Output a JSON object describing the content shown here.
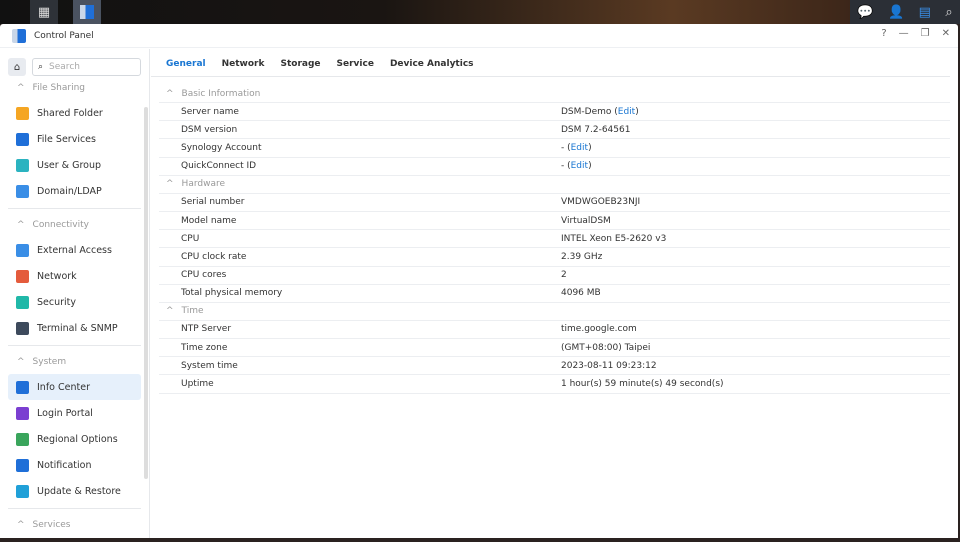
{
  "window": {
    "title": "Control Panel"
  },
  "sidebar": {
    "search_placeholder": "Search",
    "sections": [
      {
        "title": "File Sharing",
        "items": [
          {
            "label": "Shared Folder",
            "color": "#f5a623"
          },
          {
            "label": "File Services",
            "color": "#1f6fd8"
          },
          {
            "label": "User & Group",
            "color": "#2bb3c0"
          },
          {
            "label": "Domain/LDAP",
            "color": "#3a8ee6"
          }
        ]
      },
      {
        "title": "Connectivity",
        "items": [
          {
            "label": "External Access",
            "color": "#3a8ee6"
          },
          {
            "label": "Network",
            "color": "#e45b3c"
          },
          {
            "label": "Security",
            "color": "#20b8a8"
          },
          {
            "label": "Terminal & SNMP",
            "color": "#3d4a5c"
          }
        ]
      },
      {
        "title": "System",
        "items": [
          {
            "label": "Info Center",
            "color": "#1f6fd8"
          },
          {
            "label": "Login Portal",
            "color": "#7b3fd1"
          },
          {
            "label": "Regional Options",
            "color": "#3aa55c"
          },
          {
            "label": "Notification",
            "color": "#1f6fd8"
          },
          {
            "label": "Update & Restore",
            "color": "#20a0d8"
          }
        ]
      },
      {
        "title": "Services",
        "items": []
      }
    ]
  },
  "tabs": [
    "General",
    "Network",
    "Storage",
    "Service",
    "Device Analytics"
  ],
  "edit_label": "Edit",
  "groups": [
    {
      "title": "Basic Information",
      "rows": [
        [
          "Server name",
          "DSM-Demo",
          true
        ],
        [
          "DSM version",
          "DSM 7.2-64561",
          false
        ],
        [
          "Synology Account",
          "-",
          true
        ],
        [
          "QuickConnect ID",
          "-",
          true
        ]
      ]
    },
    {
      "title": "Hardware",
      "rows": [
        [
          "Serial number",
          "VMDWGOEB23NJI",
          false
        ],
        [
          "Model name",
          "VirtualDSM",
          false
        ],
        [
          "CPU",
          "INTEL Xeon E5-2620 v3",
          false
        ],
        [
          "CPU clock rate",
          "2.39 GHz",
          false
        ],
        [
          "CPU cores",
          "2",
          false
        ],
        [
          "Total physical memory",
          "4096 MB",
          false
        ]
      ]
    },
    {
      "title": "Time",
      "rows": [
        [
          "NTP Server",
          "time.google.com",
          false
        ],
        [
          "Time zone",
          "(GMT+08:00) Taipei",
          false
        ],
        [
          "System time",
          "2023-08-11 09:23:12",
          false
        ],
        [
          "Uptime",
          "1 hour(s) 59 minute(s) 49 second(s)",
          false
        ]
      ]
    }
  ]
}
